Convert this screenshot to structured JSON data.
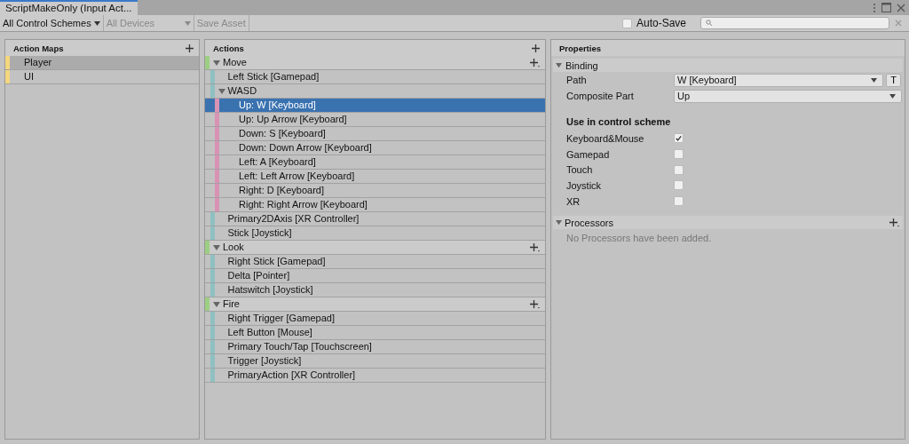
{
  "window": {
    "tab": "ScriptMakeOnly (Input Act..."
  },
  "toolbar": {
    "scheme_dropdown": "All Control Schemes",
    "devices_dropdown": {
      "label": "All Devices",
      "disabled": true
    },
    "save_button": {
      "label": "Save Asset",
      "disabled": true
    },
    "auto_save": {
      "label": "Auto-Save",
      "checked": false
    }
  },
  "action_maps": {
    "title": "Action Maps",
    "items": [
      {
        "name": "Player",
        "selected": true
      },
      {
        "name": "UI",
        "selected": false
      }
    ]
  },
  "actions": {
    "title": "Actions",
    "items": [
      {
        "kind": "action",
        "name": "Move",
        "expanded": true,
        "selected": false,
        "children": [
          {
            "kind": "binding",
            "name": "Left Stick [Gamepad]",
            "selected": false
          },
          {
            "kind": "composite",
            "name": "WASD",
            "expanded": true,
            "selected": false,
            "children": [
              {
                "kind": "part",
                "name": "Up: W [Keyboard]",
                "selected": true
              },
              {
                "kind": "part",
                "name": "Up: Up Arrow [Keyboard]",
                "selected": false
              },
              {
                "kind": "part",
                "name": "Down: S [Keyboard]",
                "selected": false
              },
              {
                "kind": "part",
                "name": "Down: Down Arrow [Keyboard]",
                "selected": false
              },
              {
                "kind": "part",
                "name": "Left: A [Keyboard]",
                "selected": false
              },
              {
                "kind": "part",
                "name": "Left: Left Arrow [Keyboard]",
                "selected": false
              },
              {
                "kind": "part",
                "name": "Right: D [Keyboard]",
                "selected": false
              },
              {
                "kind": "part",
                "name": "Right: Right Arrow [Keyboard]",
                "selected": false
              }
            ]
          },
          {
            "kind": "binding",
            "name": "Primary2DAxis [XR Controller]",
            "selected": false
          },
          {
            "kind": "binding",
            "name": "Stick [Joystick]",
            "selected": false
          }
        ]
      },
      {
        "kind": "action",
        "name": "Look",
        "expanded": true,
        "selected": false,
        "children": [
          {
            "kind": "binding",
            "name": "Right Stick [Gamepad]",
            "selected": false
          },
          {
            "kind": "binding",
            "name": "Delta [Pointer]",
            "selected": false
          },
          {
            "kind": "binding",
            "name": "Hatswitch [Joystick]",
            "selected": false
          }
        ]
      },
      {
        "kind": "action",
        "name": "Fire",
        "expanded": true,
        "selected": false,
        "children": [
          {
            "kind": "binding",
            "name": "Right Trigger [Gamepad]",
            "selected": false
          },
          {
            "kind": "binding",
            "name": "Left Button [Mouse]",
            "selected": false
          },
          {
            "kind": "binding",
            "name": "Primary Touch/Tap [Touchscreen]",
            "selected": false
          },
          {
            "kind": "binding",
            "name": "Trigger [Joystick]",
            "selected": false
          },
          {
            "kind": "binding",
            "name": "PrimaryAction [XR Controller]",
            "selected": false
          }
        ]
      }
    ]
  },
  "properties": {
    "title": "Properties",
    "binding": {
      "title": "Binding",
      "expanded": true,
      "path_label": "Path",
      "path_value": "W [Keyboard]",
      "t_button": "T",
      "part_label": "Composite Part",
      "part_value": "Up",
      "schemes_heading": "Use in control scheme",
      "schemes": [
        {
          "label": "Keyboard&Mouse",
          "checked": true
        },
        {
          "label": "Gamepad",
          "checked": false
        },
        {
          "label": "Touch",
          "checked": false
        },
        {
          "label": "Joystick",
          "checked": false
        },
        {
          "label": "XR",
          "checked": false
        }
      ]
    },
    "processors": {
      "title": "Processors",
      "expanded": true,
      "empty_message": "No Processors have been added."
    }
  }
}
